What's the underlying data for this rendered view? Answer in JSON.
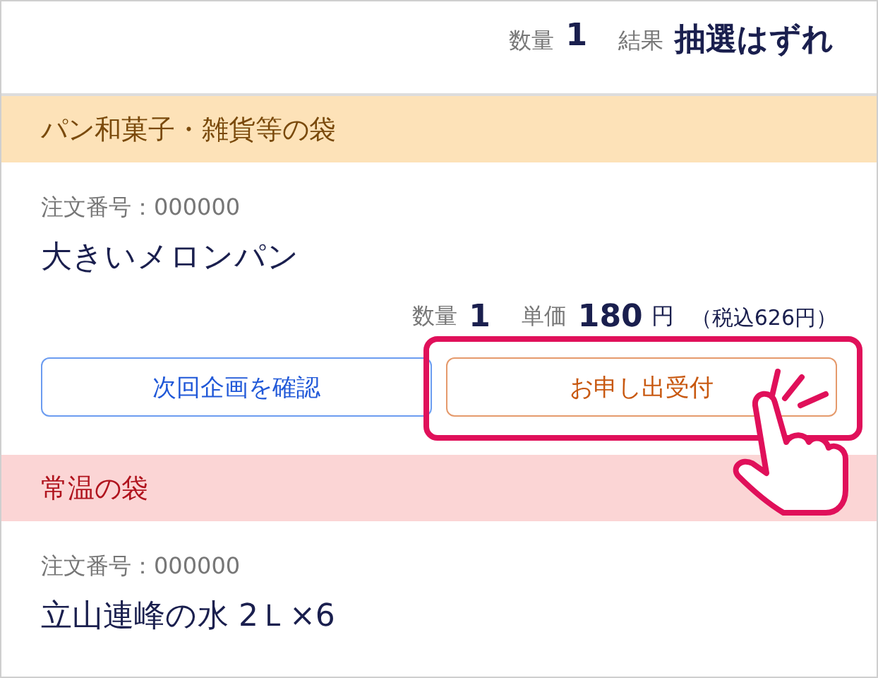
{
  "summary": {
    "quantity_label": "数量",
    "quantity": "1",
    "result_label": "結果",
    "result": "抽選はずれ"
  },
  "sections": [
    {
      "title": "パン和菓子・雑貨等の袋",
      "kind": "bakery",
      "color": "#fde2b8",
      "items": [
        {
          "order": "注文番号：000000",
          "name": "大きいメロンパン",
          "quantity_label": "数量",
          "quantity": "1",
          "price_label": "単価",
          "price": "180",
          "unit": "円",
          "tax": "（税込626円）",
          "buttons": [
            {
              "label": "次回企画を確認",
              "kind": "secondary",
              "highlighted": false
            },
            {
              "label": "お申し出受付",
              "kind": "primary",
              "highlighted": true
            }
          ]
        }
      ]
    },
    {
      "title": "常温の袋",
      "kind": "ambient",
      "color": "#fbd5d5",
      "items": [
        {
          "order": "注文番号：000000",
          "name": "立山連峰の水 2Ｌ×6"
        }
      ]
    }
  ]
}
